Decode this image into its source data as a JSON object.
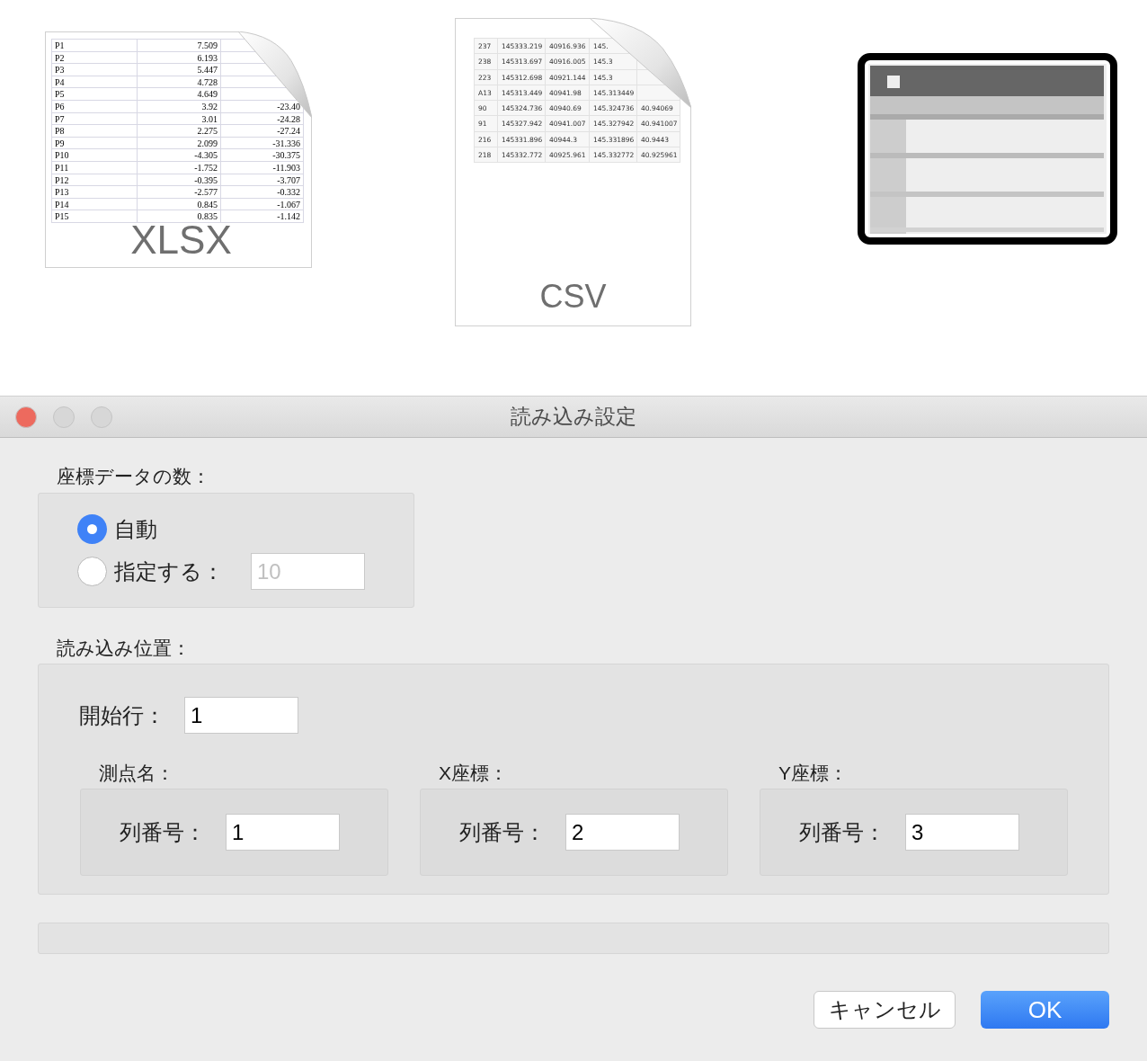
{
  "xlsx_icon": {
    "label": "XLSX",
    "rows": [
      {
        "name": "P1",
        "value": "7.509"
      },
      {
        "name": "P2",
        "value": "6.193"
      },
      {
        "name": "P3",
        "value": "5.447"
      },
      {
        "name": "P4",
        "value": "4.728"
      },
      {
        "name": "P5",
        "value": "4.649"
      },
      {
        "name": "P6",
        "value": "3.92",
        "column_3": "-23.40"
      },
      {
        "name": "P7",
        "value": "3.01",
        "column_3": "-24.28"
      },
      {
        "name": "P8",
        "value": "2.275",
        "column_3": "-27.24"
      },
      {
        "name": "P9",
        "value": "2.099",
        "column_3": "-31.336"
      },
      {
        "name": "P10",
        "value": "-4.305",
        "column_3": "-30.375"
      },
      {
        "name": "P11",
        "value": "-1.752",
        "column_3": "-11.903"
      },
      {
        "name": "P12",
        "value": "-0.395",
        "column_3": "-3.707"
      },
      {
        "name": "P13",
        "value": "-2.577",
        "column_3": "-0.332"
      },
      {
        "name": "P14",
        "value": "0.845",
        "column_3": "-1.067"
      },
      {
        "name": "P15",
        "value": "0.835",
        "column_3": "-1.142"
      }
    ]
  },
  "csv_icon": {
    "label": "CSV",
    "rows": [
      [
        "237",
        "145333.219",
        "40916.936",
        "145."
      ],
      [
        "238",
        "145313.697",
        "40916.005",
        "145.3"
      ],
      [
        "223",
        "145312.698",
        "40921.144",
        "145.3"
      ],
      [
        "A13",
        "145313.449",
        "40941.98",
        "145.313449"
      ],
      [
        "90",
        "145324.736",
        "40940.69",
        "145.324736",
        "40.94069"
      ],
      [
        "91",
        "145327.942",
        "40941.007",
        "145.327942",
        "40.941007"
      ],
      [
        "216",
        "145331.896",
        "40944.3",
        "145.331896",
        "40.9443"
      ],
      [
        "218",
        "145332.772",
        "40925.961",
        "145.332772",
        "40.925961"
      ]
    ]
  },
  "window": {
    "title": "読み込み設定",
    "controls": [
      {
        "color": "#ed6a5e"
      },
      {
        "color": "#d7d7d7"
      },
      {
        "color": "#d7d7d7"
      }
    ]
  },
  "count_section": {
    "label": "座標データの数：",
    "options": [
      {
        "label": "自動",
        "selected": true
      },
      {
        "label": "指定する：",
        "selected": false
      }
    ],
    "count_field": {
      "value": "10",
      "disabled": true
    }
  },
  "position_section": {
    "label": "読み込み位置：",
    "start_row": {
      "label": "開始行：",
      "value": "1"
    },
    "groups": [
      {
        "title": "測点名：",
        "field_label": "列番号：",
        "value": "1"
      },
      {
        "title": "X座標：",
        "field_label": "列番号：",
        "value": "2"
      },
      {
        "title": "Y座標：",
        "field_label": "列番号：",
        "value": "3"
      }
    ]
  },
  "buttons": [
    {
      "label": "キャンセル",
      "kind": "secondary"
    },
    {
      "label": "OK",
      "kind": "primary"
    }
  ]
}
